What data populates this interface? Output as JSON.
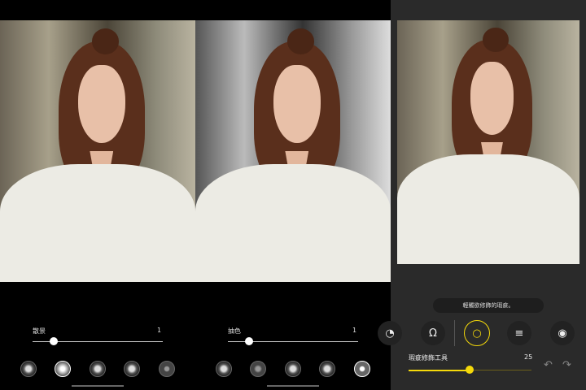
{
  "panel1": {
    "effect_label": "散景",
    "value": "1",
    "slider_fraction": 0.15,
    "selected_effect": 1
  },
  "panel2": {
    "effect_label": "抽色",
    "value": "1",
    "slider_fraction": 0.15,
    "selected_effect": 4
  },
  "panel3": {
    "hint": "輕觸欲修飾的瑕疵。",
    "tool_label": "瑕疵修飾工具",
    "value": "25",
    "slider_fraction": 0.5,
    "accent": "#f5d90a",
    "tools": [
      {
        "icon": "partial-tool-icon"
      },
      {
        "icon": "face-outline-icon"
      },
      {
        "icon": "blemish-face-icon"
      },
      {
        "icon": "adjust-icon"
      },
      {
        "icon": "eye-icon"
      }
    ]
  }
}
